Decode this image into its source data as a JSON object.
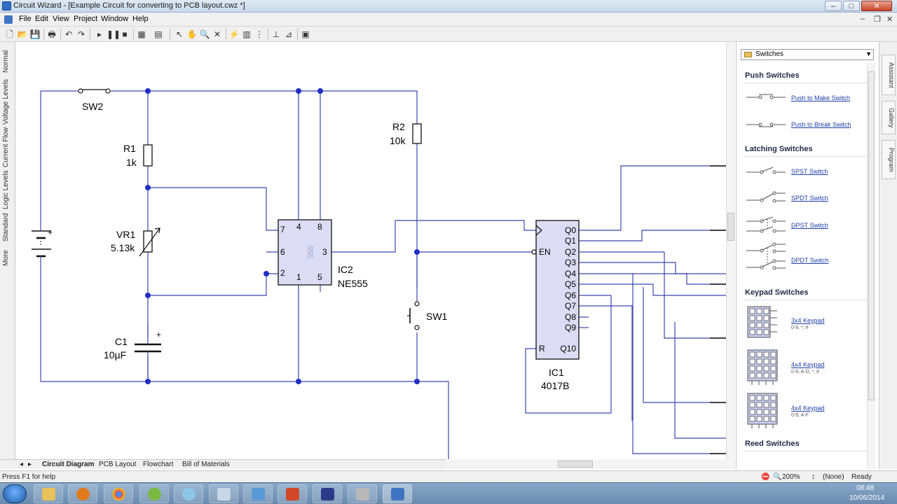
{
  "window": {
    "title": "Circuit Wizard - [Example Circuit for converting to PCB layout.cwz *]"
  },
  "menu": [
    "File",
    "Edit",
    "View",
    "Project",
    "Window",
    "Help"
  ],
  "left_tabs": [
    "Normal",
    "Voltage Levels",
    "Current Flow",
    "Logic Levels",
    "Standard",
    "More"
  ],
  "circuit": {
    "labels": {
      "sw2": "SW2",
      "r1": "R1",
      "r1_val": "1k",
      "vr1": "VR1",
      "vr1_val": "5.13k",
      "c1": "C1",
      "c1_val": "10µF",
      "c1_plus": "+",
      "bat_plus": "+",
      "r2": "R2",
      "r2_val": "10k",
      "sw1": "SW1",
      "ic2": "IC2",
      "ic2_type": "NE555",
      "ic2_body": "555",
      "ic2_p7": "7",
      "ic2_p4": "4",
      "ic2_p8": "8",
      "ic2_p6": "6",
      "ic2_p3": "3",
      "ic2_p2": "2",
      "ic2_p1": "1",
      "ic2_p5": "5",
      "ic1": "IC1",
      "ic1_type": "4017B",
      "ic1_en": "EN",
      "ic1_r": "R",
      "q0": "Q0",
      "q1": "Q1",
      "q2": "Q2",
      "q3": "Q3",
      "q4": "Q4",
      "q5": "Q5",
      "q6": "Q6",
      "q7": "Q7",
      "q8": "Q8",
      "q9": "Q9",
      "q10": "Q10"
    }
  },
  "bottom_tabs": [
    "Circuit Diagram",
    "PCB Layout",
    "Flowchart",
    "Bill of Materials"
  ],
  "gallery": {
    "selected": "Switches",
    "sections": {
      "push": "Push Switches",
      "latching": "Latching Switches",
      "keypad": "Keypad Switches",
      "reed": "Reed Switches"
    },
    "items": {
      "push_make": "Push to Make Switch",
      "push_break": "Push to Break Switch",
      "spst": "SPST Switch",
      "spdt": "SPDT Switch",
      "dpst": "DPST Switch",
      "dpdt": "DPDT Switch",
      "kp34": "3x4 Keypad",
      "kp34_sub": "0-9, *, #",
      "kp44a": "4x4 Keypad",
      "kp44a_sub": "0-9, A-D, *, #",
      "kp44b": "4x4 Keypad",
      "kp44b_sub": "0-9, A-F"
    }
  },
  "right_tabs": [
    "Assistant",
    "Gallery",
    "Program"
  ],
  "status": {
    "help": "Press F1 for help",
    "zoom": "200%",
    "mode": "(None)",
    "state": "Ready"
  },
  "clock": {
    "time": "08:48",
    "date": "10/06/2014"
  },
  "colors": {
    "wire": "#3b46b0",
    "node": "#1f2fc4",
    "ic_fill": "#dcdcf4",
    "link": "#1f3fa8"
  }
}
